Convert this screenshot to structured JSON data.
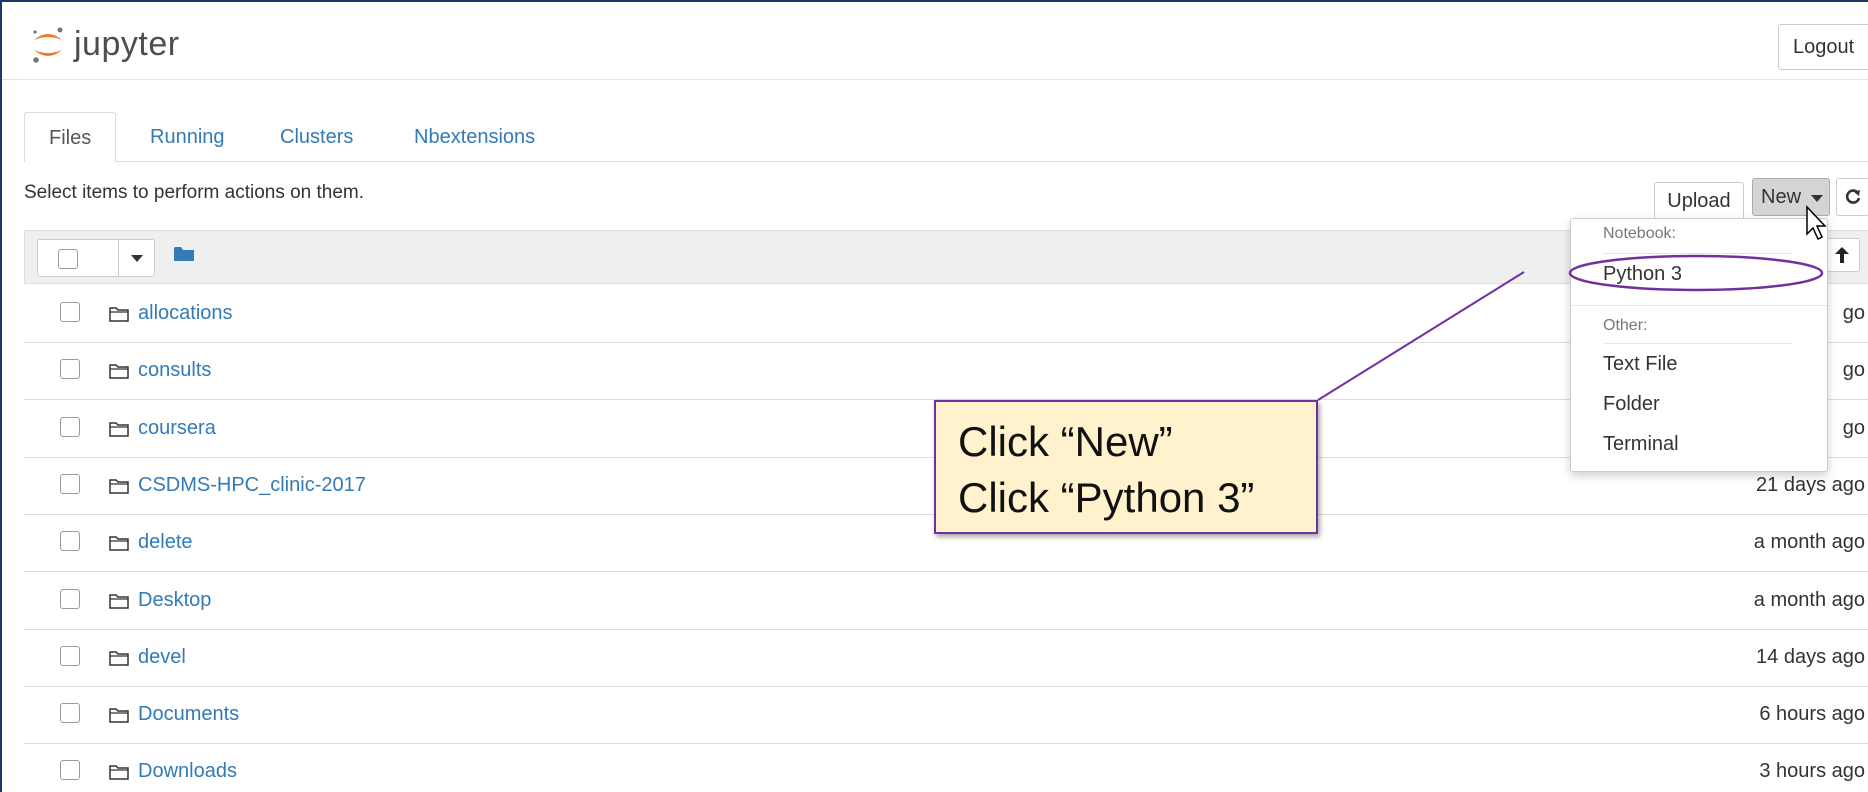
{
  "header": {
    "logo_text": "jupyter",
    "logout_label": "Logout"
  },
  "tabs": [
    {
      "label": "Files",
      "active": true
    },
    {
      "label": "Running",
      "active": false
    },
    {
      "label": "Clusters",
      "active": false
    },
    {
      "label": "Nbextensions",
      "active": false
    }
  ],
  "toolbar": {
    "hint": "Select items to perform actions on them.",
    "upload_label": "Upload",
    "new_label": "New"
  },
  "list_header": {
    "folder_icon": "folder-icon",
    "sort_icon": "arrow-up-icon"
  },
  "files": [
    {
      "name": "allocations",
      "modified": "go"
    },
    {
      "name": "consults",
      "modified": "go"
    },
    {
      "name": "coursera",
      "modified": "go"
    },
    {
      "name": "CSDMS-HPC_clinic-2017",
      "modified": "21 days ago"
    },
    {
      "name": "delete",
      "modified": "a month ago"
    },
    {
      "name": "Desktop",
      "modified": "a month ago"
    },
    {
      "name": "devel",
      "modified": "14 days ago"
    },
    {
      "name": "Documents",
      "modified": "6 hours ago"
    },
    {
      "name": "Downloads",
      "modified": "3 hours ago"
    }
  ],
  "new_menu": {
    "notebook_header": "Notebook:",
    "python3": "Python 3",
    "other_header": "Other:",
    "text_file": "Text File",
    "folder": "Folder",
    "terminal": "Terminal"
  },
  "callout": {
    "line1": "Click “New”",
    "line2": "Click “Python 3”"
  },
  "colors": {
    "link": "#337ab7",
    "callout_fill": "#fff2cc",
    "callout_border": "#7030a0",
    "logo_orange": "#f37726"
  }
}
